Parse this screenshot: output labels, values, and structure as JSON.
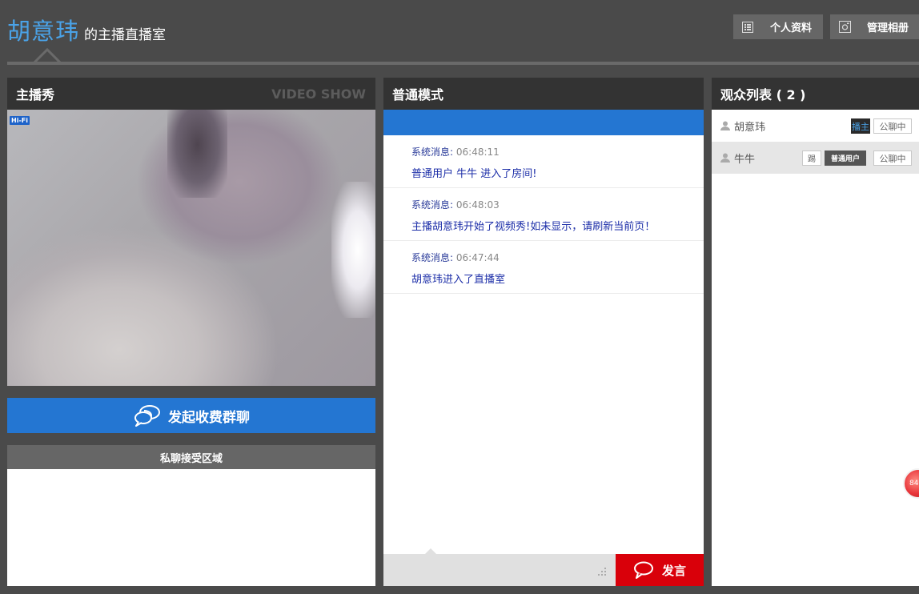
{
  "header": {
    "host_name": "胡意玮",
    "title_suffix": "的主播直播室",
    "profile_button": "个人资料",
    "album_button": "管理相册",
    "accent_color": "#4aa3e8"
  },
  "video_panel": {
    "title": "主播秀",
    "watermark": "VIDEO SHOW",
    "quality_badge": "Hi-Fi",
    "paid_group_chat_button": "发起收费群聊",
    "private_chat_title": "私聊接受区域"
  },
  "chat_panel": {
    "title": "普通模式",
    "messages": [
      {
        "sender": "系统消息:",
        "time": "06:48:11",
        "text": "普通用户 牛牛 进入了房间!"
      },
      {
        "sender": "系统消息:",
        "time": "06:48:03",
        "text": "主播胡意玮开始了视频秀!如未显示，请刷新当前页！"
      },
      {
        "sender": "系统消息:",
        "time": "06:47:44",
        "text": "胡意玮进入了直播室"
      }
    ],
    "input_value": "",
    "send_button": "发言",
    "send_color": "#d9000a"
  },
  "audience_panel": {
    "title": "观众列表 ( 2 )",
    "users": [
      {
        "name": "胡意玮",
        "role_tag": "播主",
        "chat_tag": "公聊中"
      },
      {
        "name": "牛牛",
        "kick_tag": "踢",
        "role_tag": "普通用户",
        "chat_tag": "公聊中"
      }
    ]
  },
  "floating_badge": {
    "text": "84"
  },
  "colors": {
    "primary_blue": "#2476d2",
    "dark_header": "#333333",
    "background": "#4a4a4a"
  }
}
